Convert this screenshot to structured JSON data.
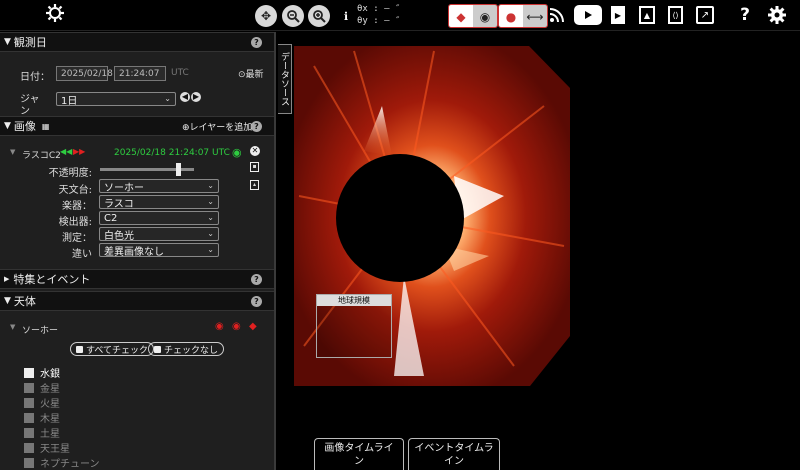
{
  "toolbar": {
    "settings_icon": "gear-icon",
    "theta_x_label": "θx",
    "theta_x_value": ": – ″",
    "theta_y_label": "θy",
    "theta_y_value": ": – ″",
    "info_glyph": "ℹ",
    "help_glyph": "?"
  },
  "observation": {
    "header": "観測日",
    "date_label": "日付：",
    "date_value": "2025/02/18",
    "time_value": "21:24:07",
    "tz": "UTC",
    "latest": "最新",
    "jump_label": "ジャンプ：",
    "jump_value": "1日"
  },
  "images": {
    "header": "画像",
    "add_layer": "レイヤーを追加",
    "layer_name": "ラスコC2",
    "layer_timestamp": "2025/02/18 21:24:07 UTC",
    "opacity_label": "不透明度:",
    "opacity": 0.85,
    "observatory_label": "天文台:",
    "observatory_value": "ソーホー",
    "instrument_label": "楽器：",
    "instrument_value": "ラスコ",
    "detector_label": "検出器:",
    "detector_value": "C2",
    "measurement_label": "測定：",
    "measurement_value": "白色光",
    "difference_label": "違い",
    "difference_value": "差異画像なし"
  },
  "features": {
    "header": "特集とイベント"
  },
  "bodies": {
    "header": "天体",
    "group": "ソーホー",
    "check_all": "すべてチェック",
    "check_none": "チェックなし",
    "items": [
      {
        "name": "水銀",
        "checked": true
      },
      {
        "name": "金星",
        "checked": false
      },
      {
        "name": "火星",
        "checked": false
      },
      {
        "name": "木星",
        "checked": false
      },
      {
        "name": "土星",
        "checked": false
      },
      {
        "name": "天王星",
        "checked": false
      },
      {
        "name": "ネプチューン",
        "checked": false
      }
    ]
  },
  "viewport": {
    "data_source_tab": "データソース",
    "earth_scale": "地球規模",
    "image_timeline": [
      "画像タイムライ",
      "ン"
    ],
    "event_timeline": [
      "イベントタイムラ",
      "イン"
    ]
  },
  "colors": {
    "accent_green": "#2ecc40",
    "accent_red": "#e02020",
    "corona": "#c02a12"
  }
}
